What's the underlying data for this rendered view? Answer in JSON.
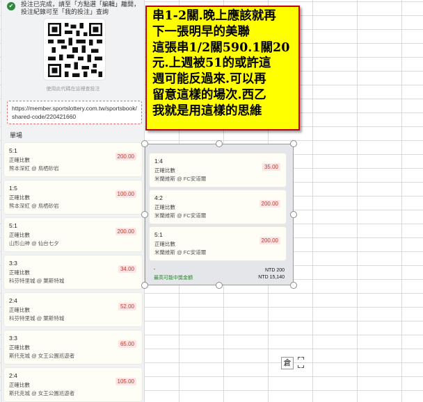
{
  "notice": {
    "text": "投注已完成，請至「方點選「編輯」離開，投注紀錄可至「我的投注」查詢",
    "qr_caption": "使用此代碼在這裡查投注"
  },
  "share_url": "https://member.sportslottery.com.tw/sportsbook/shared-code/220421660",
  "section_label": "單場",
  "bets": [
    {
      "score": "5:1",
      "type": "正確比數",
      "teams": "熊本深紅 @ 鳥栖砂岩",
      "amount": "200.00"
    },
    {
      "score": "1:5",
      "type": "正確比數",
      "teams": "熊本深紅 @ 鳥栖砂岩",
      "amount": "100.00"
    },
    {
      "score": "5:1",
      "type": "正確比數",
      "teams": "山形山神 @ 仙台七夕",
      "amount": "200.00"
    },
    {
      "score": "3:3",
      "type": "正確比數",
      "teams": "科芬特里城 @ 葉斯特城",
      "amount": "34.00"
    },
    {
      "score": "2:4",
      "type": "正確比數",
      "teams": "科芬特里城 @ 葉斯特城",
      "amount": "52.00"
    },
    {
      "score": "3:3",
      "type": "正確比數",
      "teams": "斯托克城 @ 女王公園巡遊者",
      "amount": "65.00"
    },
    {
      "score": "2:4",
      "type": "正確比數",
      "teams": "斯托克城 @ 女王公園巡遊者",
      "amount": "105.00"
    }
  ],
  "float_bets": [
    {
      "score": "1:4",
      "type": "正確比數",
      "teams": "米蘭維斯 @ FC安道爾",
      "amount": "35.00"
    },
    {
      "score": "4:2",
      "type": "正確比數",
      "teams": "米蘭維斯 @ FC安道爾",
      "amount": "200.00"
    },
    {
      "score": "5:1",
      "type": "正確比數",
      "teams": "米蘭維斯 @ FC安道爾",
      "amount": "200.00"
    }
  ],
  "float_footer": {
    "dash": "-",
    "label": "最高可能中獎金額",
    "stake": "NTD 200",
    "payout": "NTD 15,140"
  },
  "callout": {
    "lines": [
      "串1-2關.晚上應該就再",
      "下一張明早的美聯",
      "這張串1/2關590.1關20",
      "元.上週被51的或許這",
      "週可能反過來.可以再",
      "留意這樣的場次.西乙",
      "我就是用這樣的思維"
    ]
  },
  "paste_widget": {
    "glyph": "倉"
  }
}
